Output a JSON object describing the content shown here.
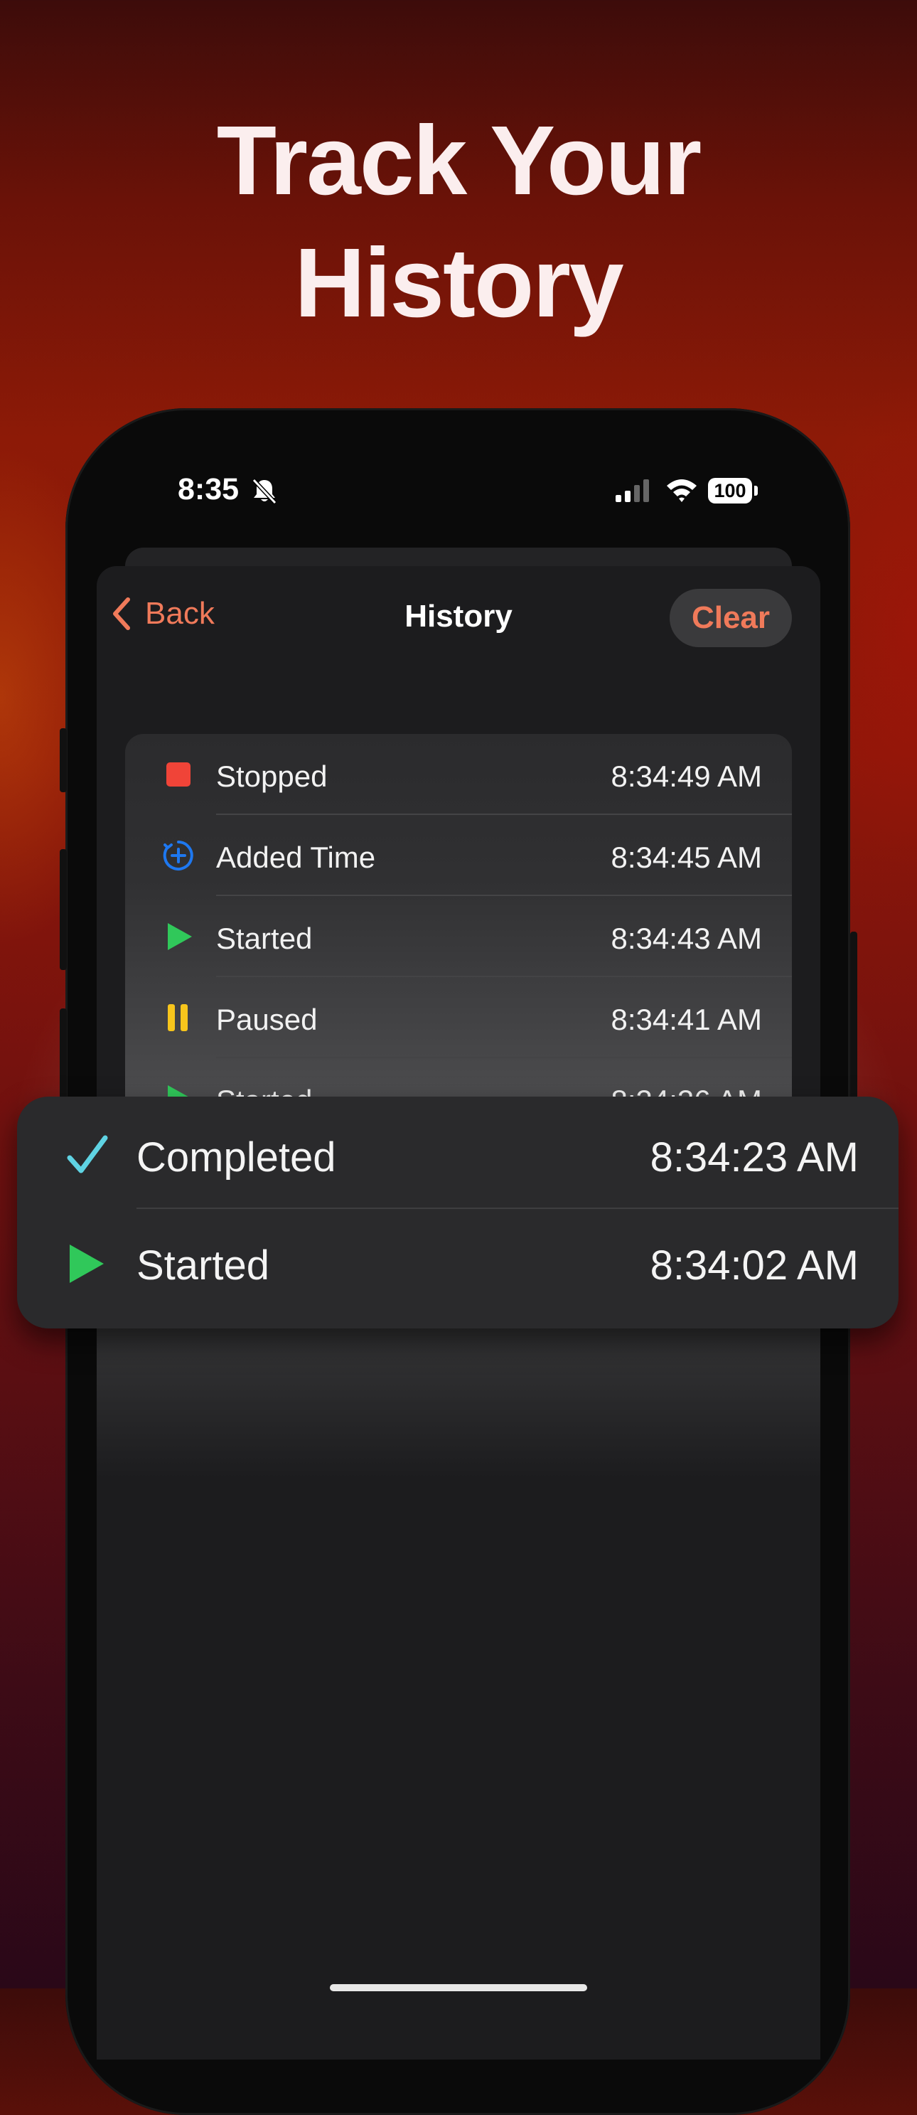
{
  "headline": {
    "line1": "Track Your",
    "line2": "History"
  },
  "status_bar": {
    "time": "8:35",
    "battery": "100",
    "icons": [
      "bell-slash-icon",
      "cellular-signal-icon",
      "wifi-icon",
      "battery-icon"
    ]
  },
  "nav": {
    "back_label": "Back",
    "title": "History",
    "clear_label": "Clear"
  },
  "history_list": [
    {
      "event": "Stopped",
      "time": "8:34:49 AM",
      "icon": "stop-square-icon",
      "color": "#f04438"
    },
    {
      "event": "Added Time",
      "time": "8:34:45 AM",
      "icon": "add-time-icon",
      "color": "#1e78f0"
    },
    {
      "event": "Started",
      "time": "8:34:43 AM",
      "icon": "play-icon",
      "color": "#30c85a"
    },
    {
      "event": "Paused",
      "time": "8:34:41 AM",
      "icon": "pause-icon",
      "color": "#f7c51c"
    },
    {
      "event": "Started",
      "time": "8:34:36 AM",
      "icon": "play-icon",
      "color": "#30c85a"
    }
  ],
  "highlight_card": [
    {
      "event": "Completed",
      "time": "8:34:23 AM",
      "icon": "checkmark-icon",
      "color": "#5fd3e3"
    },
    {
      "event": "Started",
      "time": "8:34:02 AM",
      "icon": "play-icon",
      "color": "#30c85a"
    }
  ],
  "colors": {
    "accent": "#f07a5a",
    "background_top": "#3d0c0a",
    "background_mid": "#8d1a07",
    "background_bottom": "#2a0818"
  }
}
